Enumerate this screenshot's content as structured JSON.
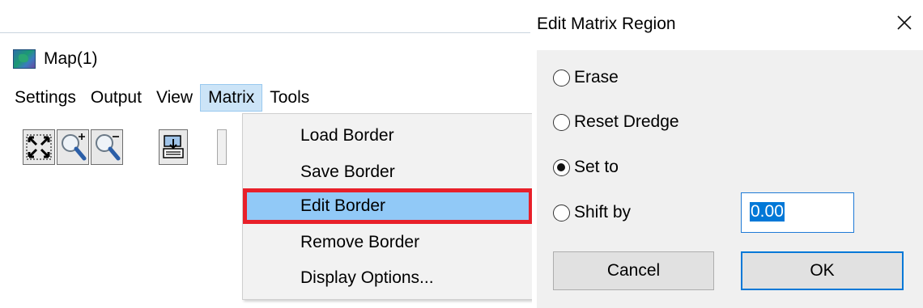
{
  "map_window": {
    "title": "Map(1)",
    "menubar": [
      "Settings",
      "Output",
      "View",
      "Matrix",
      "Tools"
    ],
    "open_menu": "Matrix",
    "toolbar_icons": [
      "zoom-extents-icon",
      "zoom-in-icon",
      "zoom-out-icon",
      "export-icon"
    ],
    "dropdown": {
      "items": [
        "Load Border",
        "Save Border",
        "Edit Border",
        "Remove Border",
        "Display Options..."
      ],
      "highlighted": "Edit Border",
      "highlight_color": "#91c9f7",
      "annotation_color": "#e8202a"
    }
  },
  "dialog": {
    "title": "Edit Matrix Region",
    "close_icon": "close-icon",
    "options": [
      {
        "label": "Erase",
        "checked": false
      },
      {
        "label": "Reset Dredge",
        "checked": false
      },
      {
        "label": "Set to",
        "checked": true
      },
      {
        "label": "Shift by",
        "checked": false
      }
    ],
    "shift_value": "0.00",
    "cancel_label": "Cancel",
    "ok_label": "OK",
    "accent_color": "#0078d7"
  }
}
